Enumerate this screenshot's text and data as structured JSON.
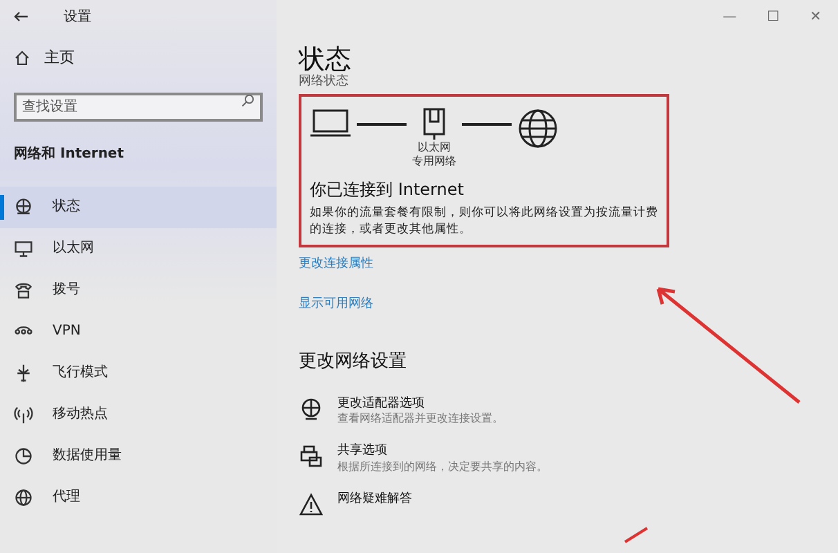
{
  "window": {
    "title": "设置",
    "controls": [
      "—",
      "☐",
      "✕"
    ]
  },
  "sidebar": {
    "home": "主页",
    "search": {
      "placeholder": "查找设置"
    },
    "section": "网络和 Internet",
    "items": [
      {
        "label": "状态",
        "kind": "status",
        "selected": true
      },
      {
        "label": "以太网",
        "kind": "ethernet",
        "selected": false
      },
      {
        "label": "拨号",
        "kind": "dialup",
        "selected": false
      },
      {
        "label": "VPN",
        "kind": "vpn",
        "selected": false
      },
      {
        "label": "飞行模式",
        "kind": "airplane",
        "selected": false
      },
      {
        "label": "移动热点",
        "kind": "hotspot",
        "selected": false
      },
      {
        "label": "数据使用量",
        "kind": "data",
        "selected": false
      },
      {
        "label": "代理",
        "kind": "proxy",
        "selected": false
      }
    ]
  },
  "main": {
    "title": "状态",
    "subtitle": "网络状态",
    "status_card": {
      "adapter_name": "以太网",
      "network_type": "专用网络",
      "heading": "你已连接到 Internet",
      "text": "如果你的流量套餐有限制，则你可以将此网络设置为按流量计费的连接，或者更改其他属性。"
    },
    "links": [
      "更改连接属性",
      "显示可用网络"
    ],
    "section_title": "更改网络设置",
    "options": [
      {
        "kind": "adapter",
        "title": "更改适配器选项",
        "description": "查看网络适配器并更改连接设置。"
      },
      {
        "kind": "sharing",
        "title": "共享选项",
        "description": "根据所连接到的网络，决定要共享的内容。"
      },
      {
        "kind": "troubleshoot",
        "title": "网络疑难解答"
      }
    ]
  }
}
